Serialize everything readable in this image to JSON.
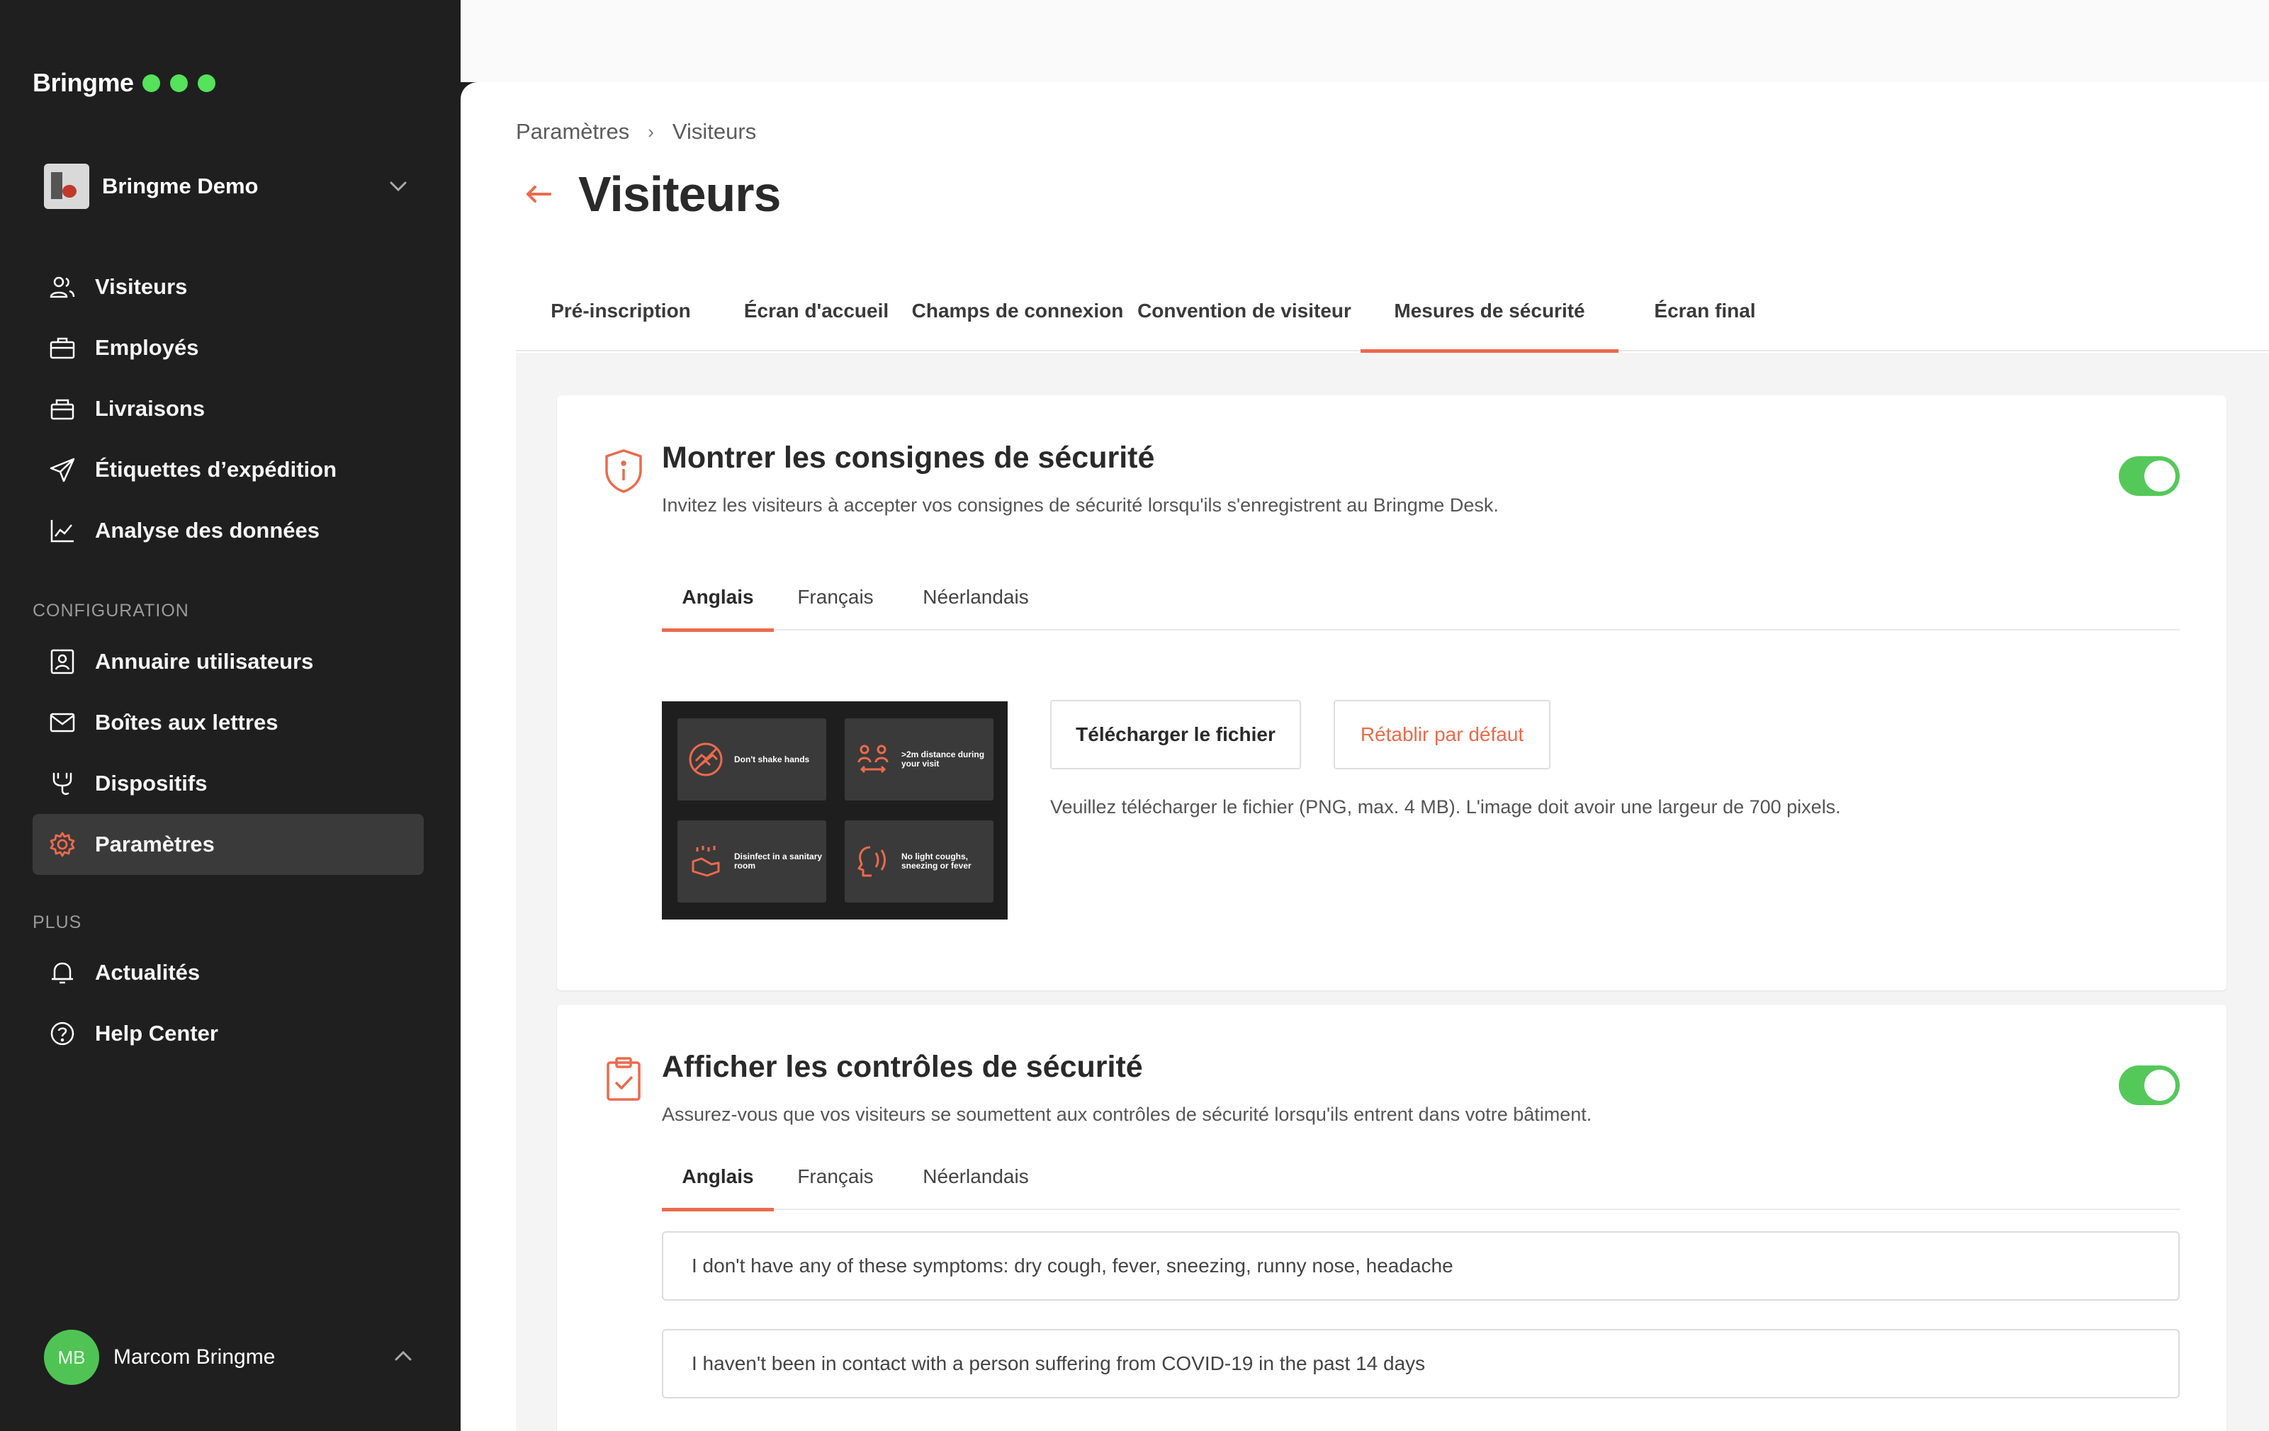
{
  "brand": {
    "name": "Bringme",
    "accent": "#ec6a4c",
    "green": "#54e35a"
  },
  "org": {
    "name": "Bringme Demo"
  },
  "sidebar": {
    "items": [
      {
        "label": "Visiteurs",
        "icon": "users-icon"
      },
      {
        "label": "Employés",
        "icon": "briefcase-icon"
      },
      {
        "label": "Livraisons",
        "icon": "package-icon"
      },
      {
        "label": "Étiquettes d’expédition",
        "icon": "send-icon"
      },
      {
        "label": "Analyse des données",
        "icon": "chart-icon"
      }
    ],
    "config_title": "CONFIGURATION",
    "config_items": [
      {
        "label": "Annuaire utilisateurs",
        "icon": "contact-card-icon"
      },
      {
        "label": "Boîtes aux lettres",
        "icon": "mail-icon"
      },
      {
        "label": "Dispositifs",
        "icon": "plug-icon"
      },
      {
        "label": "Paramètres",
        "icon": "gear-icon",
        "active": true
      }
    ],
    "plus_title": "PLUS",
    "plus_items": [
      {
        "label": "Actualités",
        "icon": "bell-icon"
      },
      {
        "label": "Help Center",
        "icon": "help-icon"
      }
    ]
  },
  "user": {
    "initials": "MB",
    "name": "Marcom Bringme"
  },
  "breadcrumb": {
    "parent": "Paramètres",
    "current": "Visiteurs"
  },
  "page": {
    "title": "Visiteurs"
  },
  "tabs": [
    {
      "label": "Pré-inscription"
    },
    {
      "label": "Écran d'accueil"
    },
    {
      "label": "Champs de connexion"
    },
    {
      "label": "Convention de visiteur"
    },
    {
      "label": "Mesures de sécurité",
      "active": true
    },
    {
      "label": "Écran final"
    }
  ],
  "languages": [
    "Anglais",
    "Français",
    "Néerlandais"
  ],
  "safety_instructions": {
    "title": "Montrer les consignes de sécurité",
    "description": "Invitez les visiteurs à accepter vos consignes de sécurité lorsqu'ils s'enregistrent au Bringme Desk.",
    "enabled": true,
    "preview_items": [
      "Don't shake hands",
      ">2m distance during your visit",
      "Disinfect in a sanitary room",
      "No light coughs, sneezing or fever"
    ],
    "upload_label": "Télécharger le fichier",
    "reset_label": "Rétablir par défaut",
    "hint": "Veuillez télécharger le fichier (PNG, max. 4 MB). L'image doit avoir une largeur de 700 pixels."
  },
  "safety_checks": {
    "title": "Afficher les contrôles de sécurité",
    "description": "Assurez-vous que vos visiteurs se soumettent aux contrôles de sécurité lorsqu'ils entrent dans votre bâtiment.",
    "enabled": true,
    "questions": [
      "I don't have any of these symptoms: dry cough, fever, sneezing, runny nose, headache",
      "I haven't been in contact with a person suffering from COVID-19 in the past 14 days"
    ]
  }
}
